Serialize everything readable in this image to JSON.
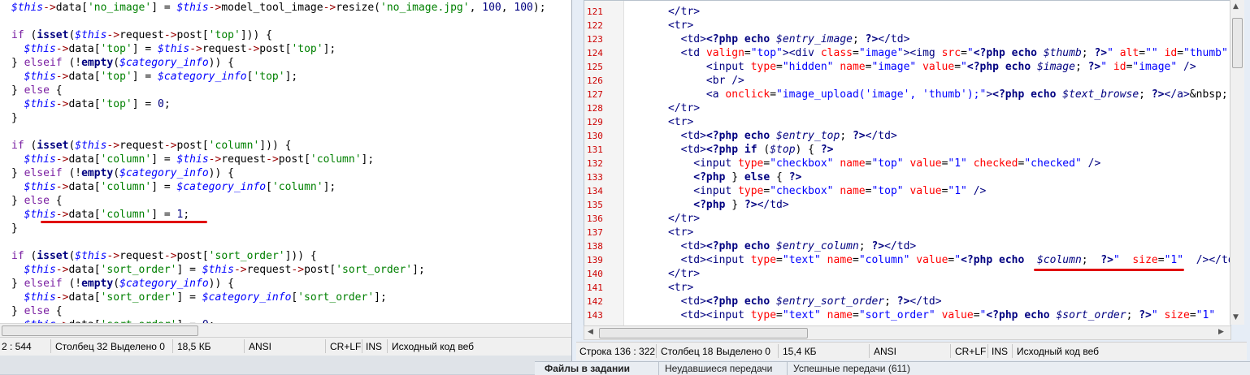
{
  "left_editor": {
    "status": {
      "line": "2 : 544",
      "column": "Столбец 32",
      "selected": "Выделено 0",
      "size": "18,5 КБ",
      "encoding": "ANSI",
      "line_ending": "CR+LF",
      "insert_mode": "INS",
      "syntax": "Исходный код веб"
    }
  },
  "right_editor": {
    "line_numbers": [
      "121",
      "122",
      "123",
      "124",
      "125",
      "126",
      "127",
      "128",
      "129",
      "130",
      "131",
      "132",
      "133",
      "134",
      "135",
      "136",
      "137",
      "138",
      "139",
      "140",
      "141",
      "142",
      "143"
    ],
    "status": {
      "line": "Строка 136 : 322",
      "column": "Столбец 18",
      "selected": "Выделено 0",
      "size": "15,4 КБ",
      "encoding": "ANSI",
      "line_ending": "CR+LF",
      "insert_mode": "INS",
      "syntax": "Исходный код веб"
    }
  },
  "bottom_tabs": {
    "tab1": "Файлы в задании",
    "tab2": "Неудавшиеся передачи",
    "tab3": "Успешные передачи (611)"
  },
  "colors": {
    "underline": "#e01010",
    "line_number": "#cc0000",
    "php_variable": "#0000ff"
  }
}
